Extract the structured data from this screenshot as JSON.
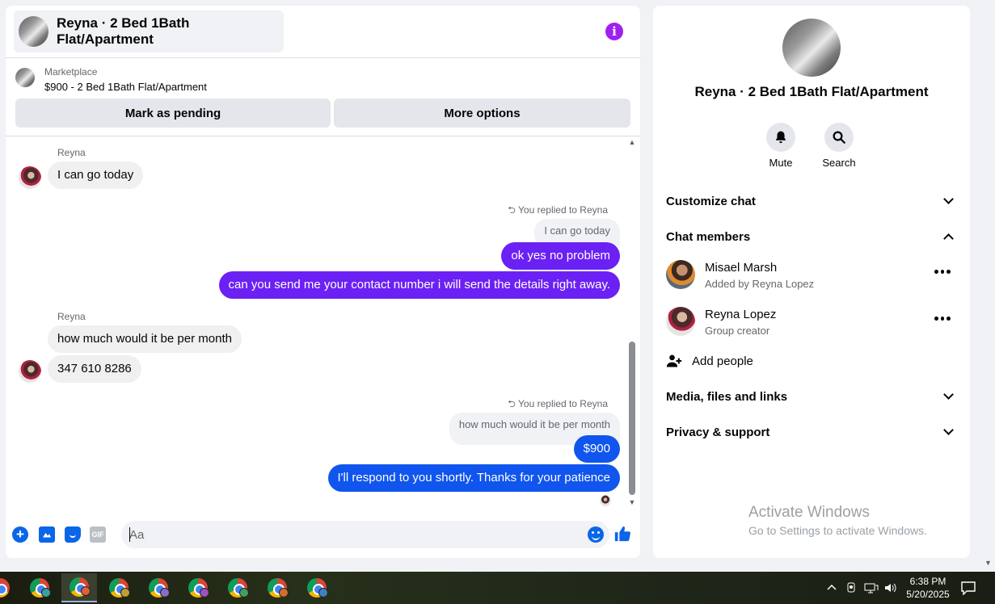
{
  "header": {
    "title": "Reyna · 2 Bed 1Bath Flat/Apartment"
  },
  "marketplace": {
    "label": "Marketplace",
    "listing": "$900 - 2 Bed 1Bath Flat/Apartment",
    "pending_button": "Mark as pending",
    "options_button": "More options"
  },
  "messages": {
    "sender1": "Reyna",
    "m1": "I can go today",
    "reply_note1": "You replied to Reyna",
    "quote1": "I can go today",
    "m2": "ok yes no problem",
    "m3": "can you send me your contact number i will send the details right away.",
    "sender2": "Reyna",
    "m4": "how much would it be per month",
    "m5": "347 610 8286",
    "reply_note2": "You replied to Reyna",
    "quote2": "how much would it be per month",
    "m6": "$900",
    "m7": "I'll respond to you shortly. Thanks for your patience"
  },
  "composer": {
    "placeholder": "Aa",
    "gif_label": "GIF"
  },
  "side": {
    "title": "Reyna · 2 Bed 1Bath Flat/Apartment",
    "mute_label": "Mute",
    "search_label": "Search",
    "customize": "Customize chat",
    "members_header": "Chat members",
    "members": [
      {
        "name": "Misael Marsh",
        "sub": "Added by Reyna Lopez"
      },
      {
        "name": "Reyna Lopez",
        "sub": "Group creator"
      }
    ],
    "add_people": "Add people",
    "media": "Media, files and links",
    "privacy": "Privacy & support"
  },
  "watermark": {
    "line1": "Activate Windows",
    "line2": "Go to Settings to activate Windows."
  },
  "taskbar": {
    "time": "6:38 PM",
    "date": "5/20/2025"
  },
  "colors": {
    "outgoing_purple": "#6b21f3",
    "outgoing_blue": "#1055ee",
    "incoming": "#f0f0f0",
    "accent": "#0a66e8"
  }
}
